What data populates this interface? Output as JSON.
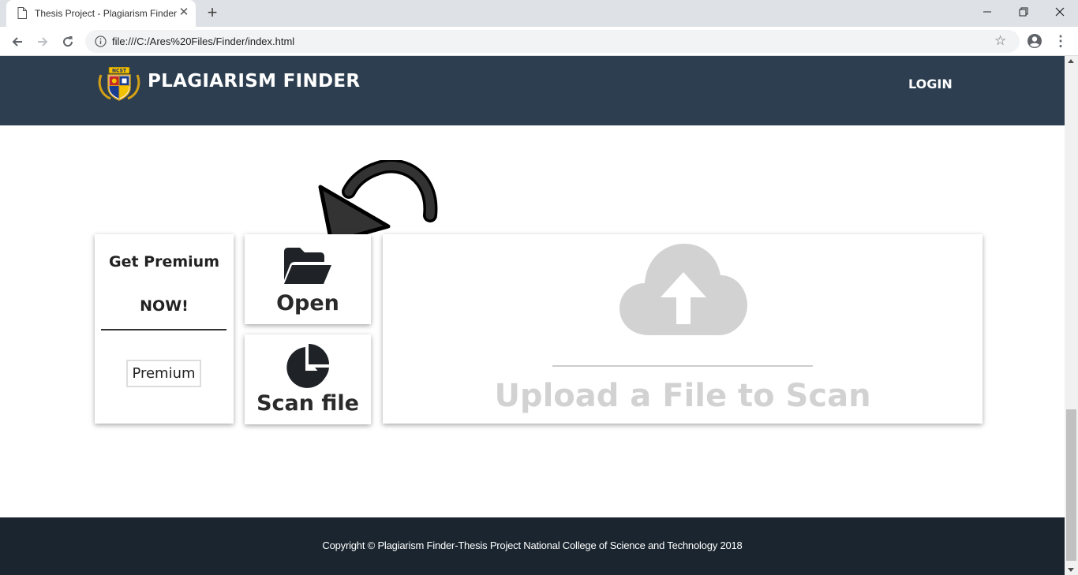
{
  "browser": {
    "tab_title": "Thesis Project - Plagiarism Finder",
    "tab_close": "✕",
    "new_tab": "+",
    "url": "file:///C:/Ares%20Files/Finder/index.html",
    "icons": [
      "page-icon",
      "close-icon",
      "plus-icon",
      "minimize-icon",
      "maximize-icon",
      "close-window-icon",
      "back-arrow-icon",
      "forward-arrow-icon",
      "reload-icon",
      "info-icon",
      "star-icon",
      "profile-icon",
      "menu-dots-icon"
    ]
  },
  "header": {
    "brand": "PLAGIARISM FINDER",
    "logo_text": "NCST",
    "login": "LOGIN",
    "background": "#2c3e50"
  },
  "premium": {
    "title": "Get Premium",
    "now": "NOW!",
    "button": "Premium"
  },
  "tiles": {
    "open": "Open",
    "scan": "Scan file"
  },
  "upload": {
    "text": "Upload a File to Scan",
    "icon": "cloud-upload-icon",
    "color": "#d2d2d2"
  },
  "footer": {
    "copyright": "Copyright © Plagiarism Finder-Thesis Project National College of Science and Technology 2018",
    "background": "#1a252f"
  }
}
